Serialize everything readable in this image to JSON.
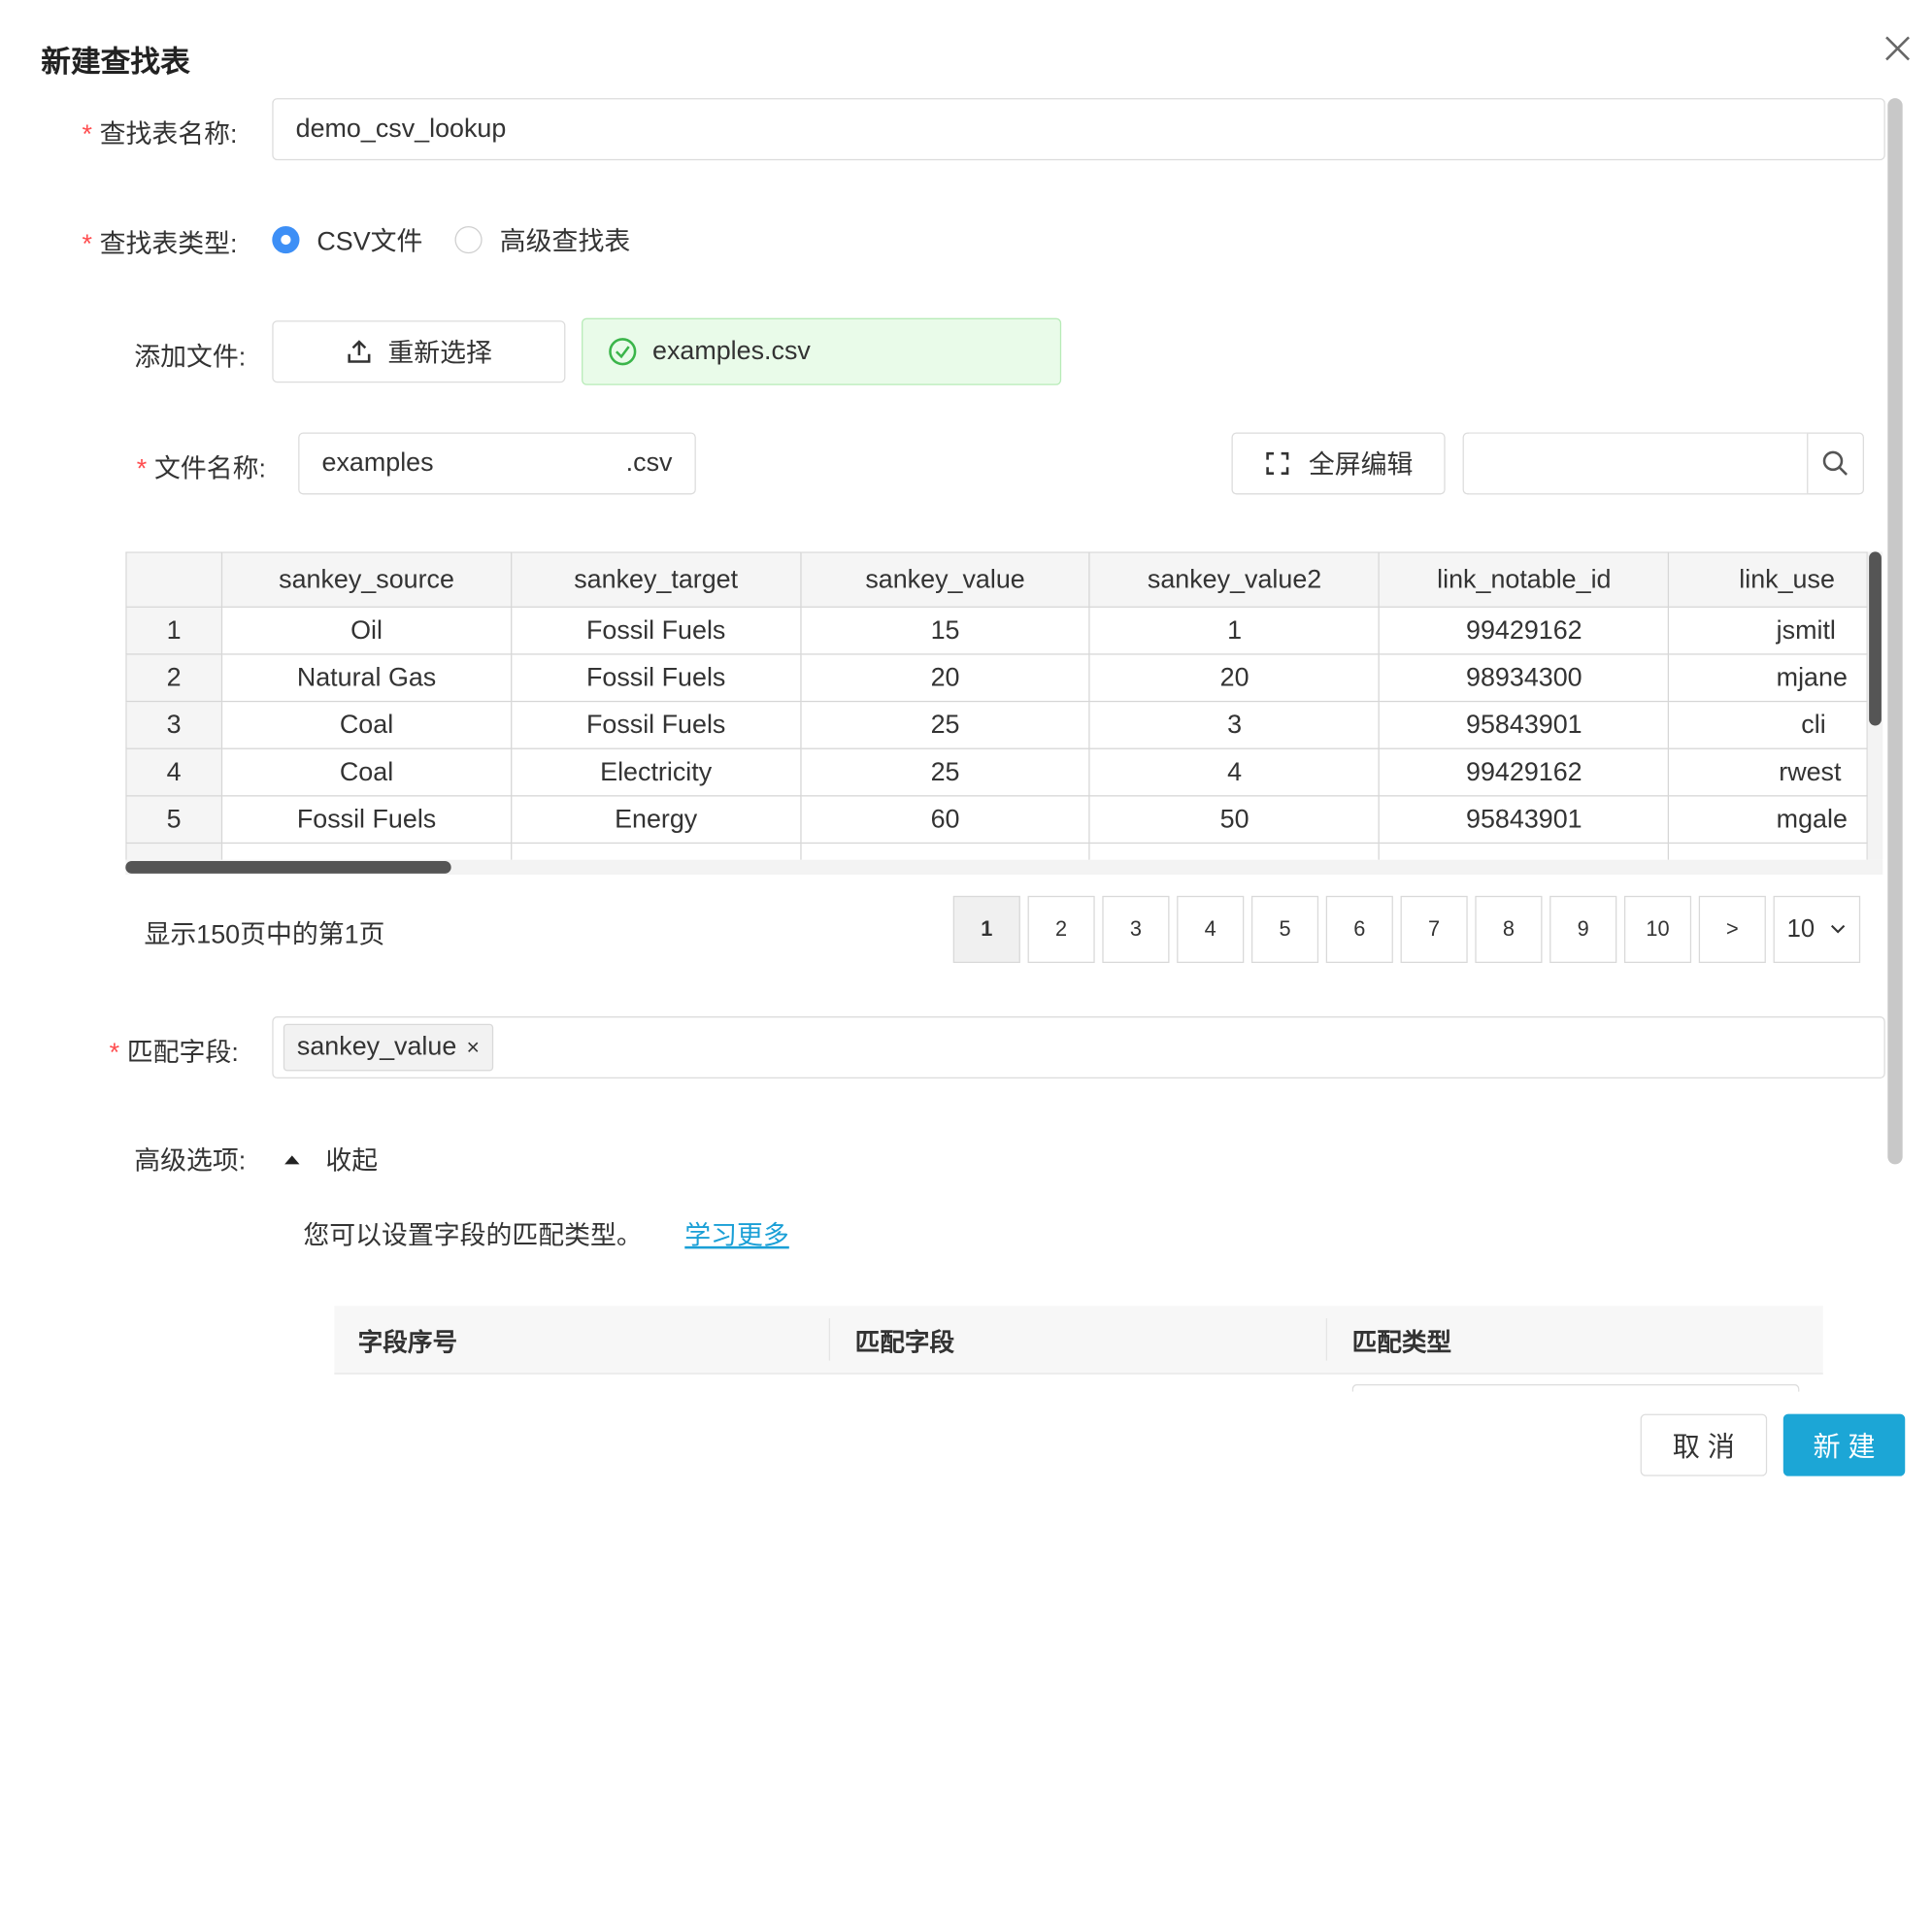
{
  "dialog": {
    "title": "新建查找表"
  },
  "form": {
    "name_label": "查找表名称:",
    "name_value": "demo_csv_lookup",
    "type_label": "查找表类型:",
    "type_options": [
      "CSV文件",
      "高级查找表"
    ],
    "type_selected": "CSV文件",
    "file_label": "添加文件:",
    "reselect_label": "重新选择",
    "uploaded_file": "examples.csv",
    "filename_label": "文件名称:",
    "filename_value": "examples",
    "filename_ext": ".csv",
    "fullscreen_label": "全屏编辑",
    "search_placeholder": ""
  },
  "grid": {
    "columns": [
      "",
      "sankey_source",
      "sankey_target",
      "sankey_value",
      "sankey_value2",
      "link_notable_id",
      "link_use"
    ],
    "rows": [
      [
        "1",
        "Oil",
        "Fossil Fuels",
        "15",
        "1",
        "99429162",
        "jsmitl"
      ],
      [
        "2",
        "Natural Gas",
        "Fossil Fuels",
        "20",
        "20",
        "98934300",
        "mjane"
      ],
      [
        "3",
        "Coal",
        "Fossil Fuels",
        "25",
        "3",
        "95843901",
        "cli"
      ],
      [
        "4",
        "Coal",
        "Electricity",
        "25",
        "4",
        "99429162",
        "rwest"
      ],
      [
        "5",
        "Fossil Fuels",
        "Energy",
        "60",
        "50",
        "95843901",
        "mgale"
      ]
    ]
  },
  "pagination": {
    "summary": "显示150页中的第1页",
    "pages": [
      "1",
      "2",
      "3",
      "4",
      "5",
      "6",
      "7",
      "8",
      "9",
      "10"
    ],
    "current": "1",
    "next": ">",
    "page_size": "10"
  },
  "match": {
    "label": "匹配字段:",
    "tags": [
      "sankey_value"
    ]
  },
  "advanced": {
    "label": "高级选项:",
    "toggle": "收起",
    "hint": "您可以设置字段的匹配类型。",
    "learn_more": "学习更多",
    "table_headers": [
      "字段序号",
      "匹配字段",
      "匹配类型"
    ]
  },
  "footer": {
    "cancel": "取 消",
    "create": "新 建"
  },
  "colors": {
    "primary": "#1ca6d6",
    "radio": "#3d8ff6",
    "required": "#ff4d4f",
    "success_bg": "#e9fbe9"
  }
}
